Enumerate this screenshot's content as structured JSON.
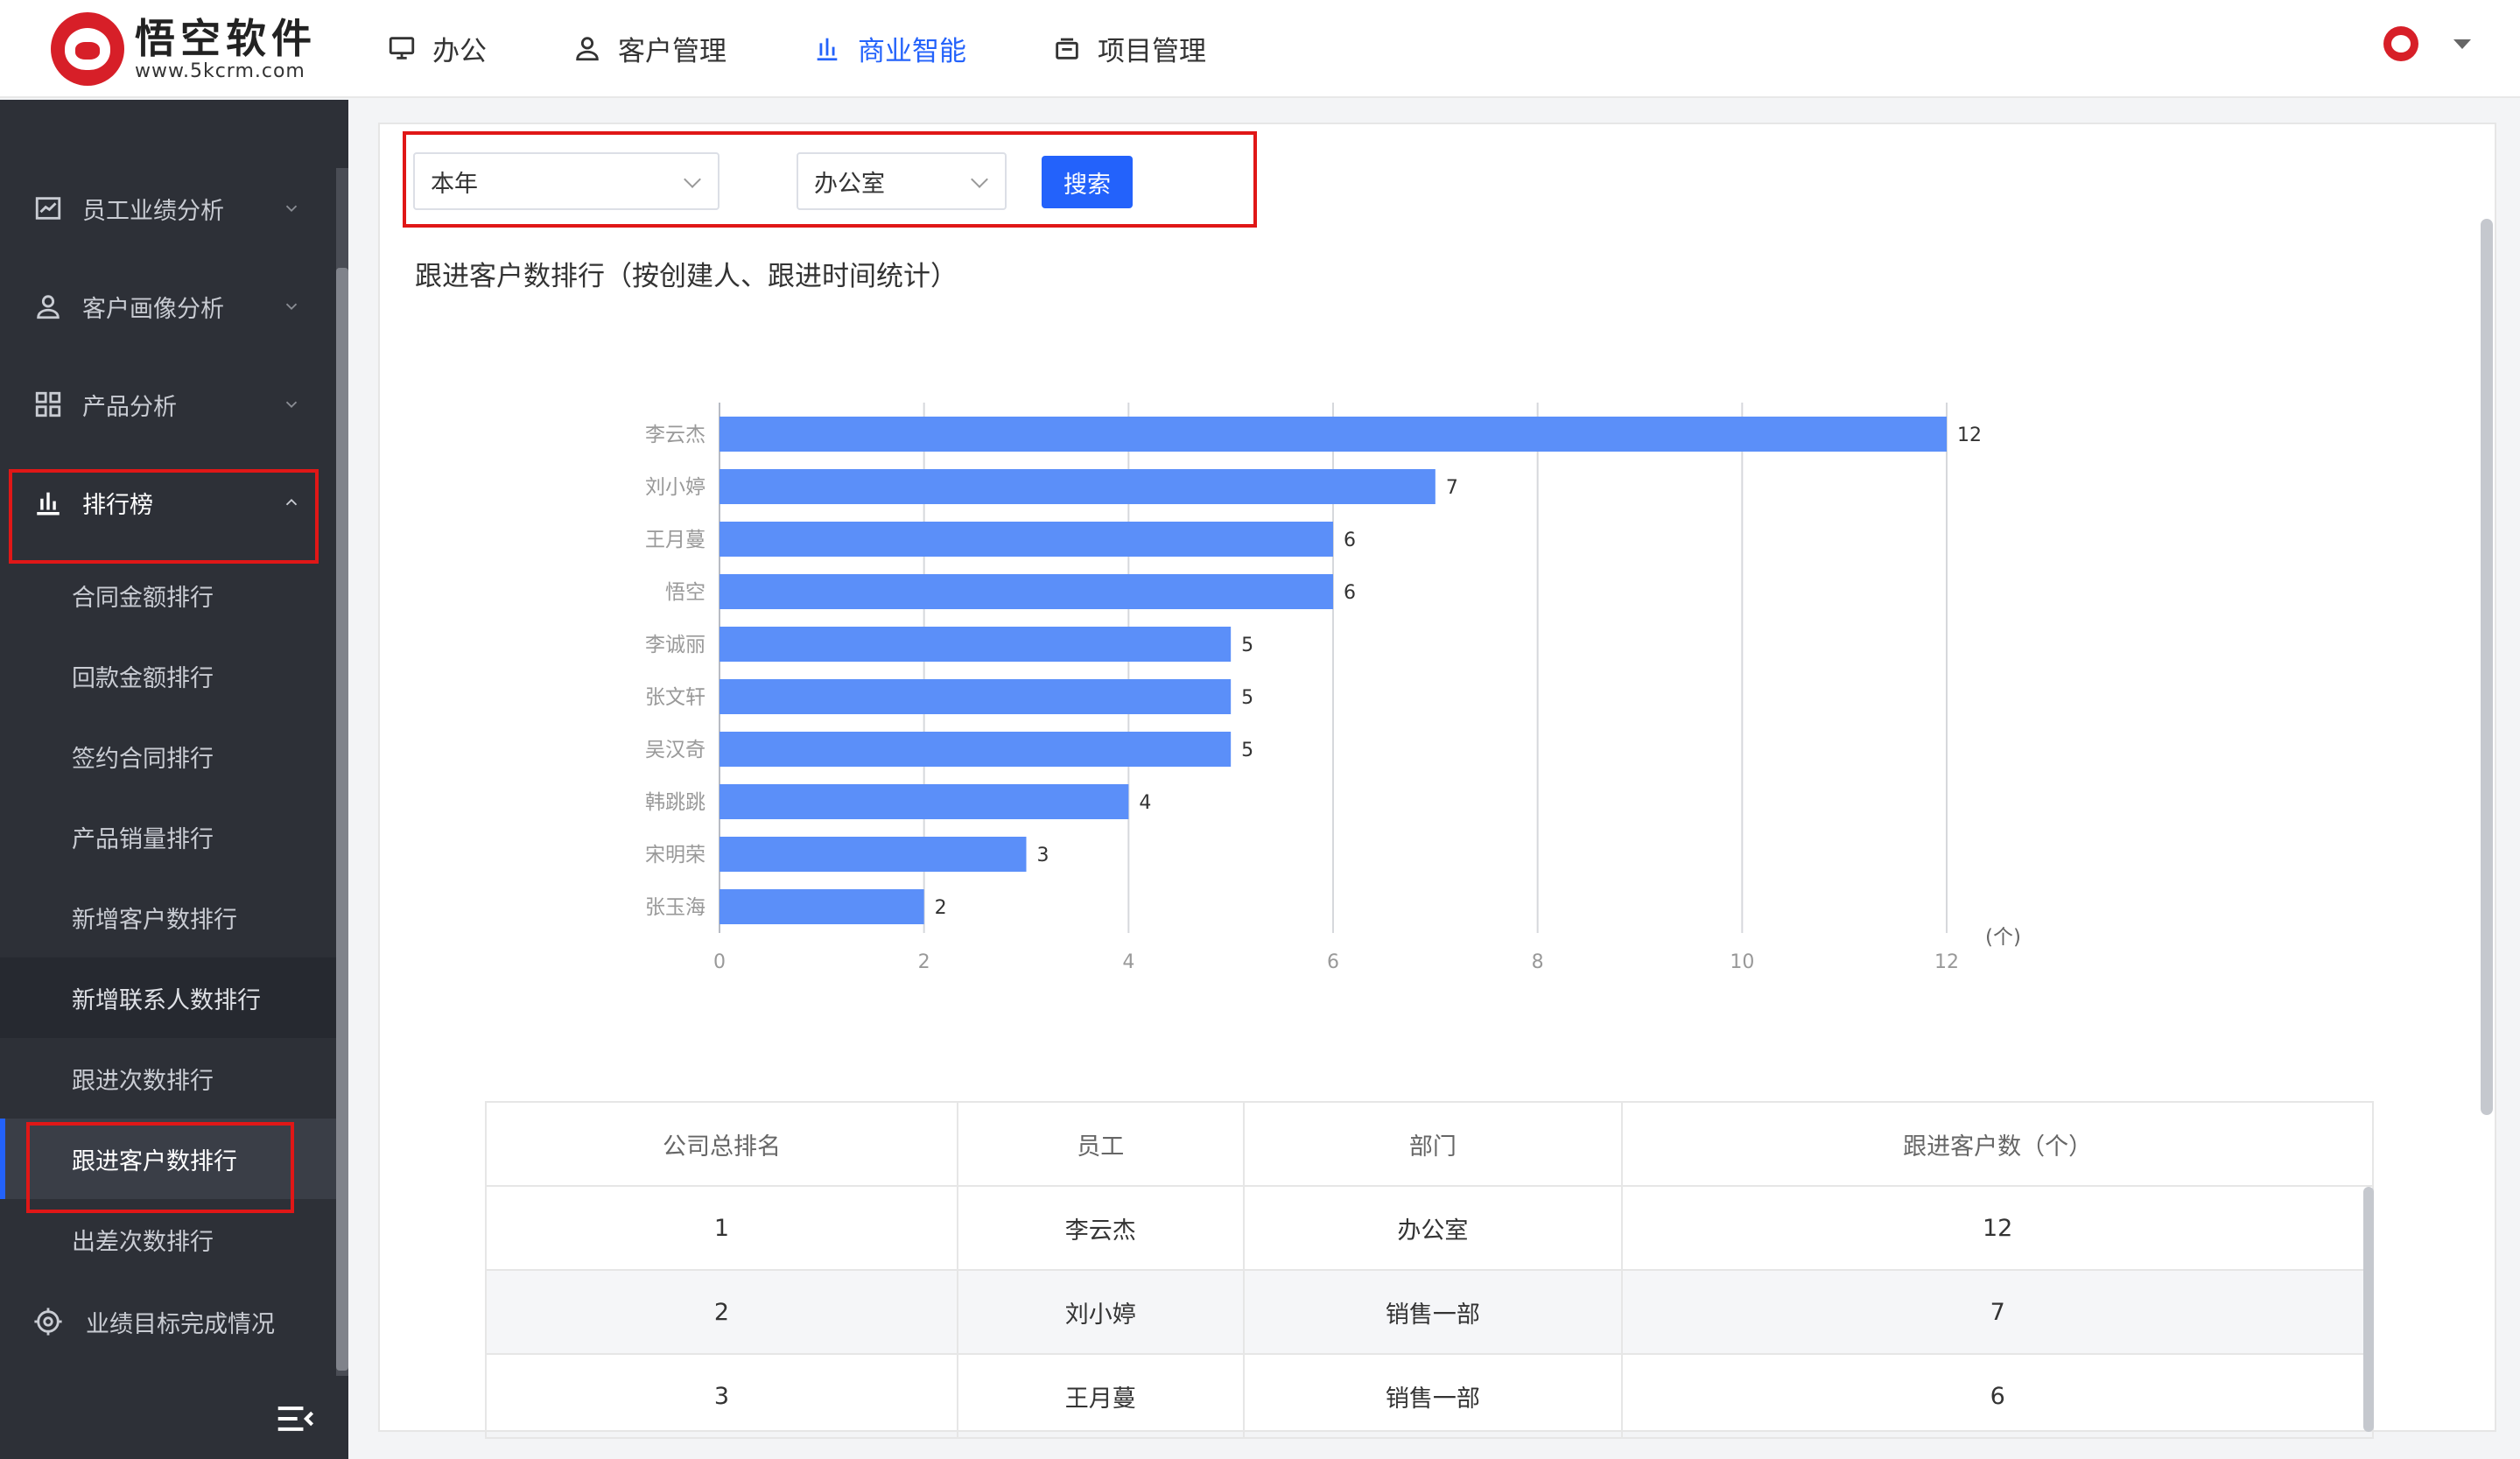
{
  "brand": {
    "name": "悟空软件",
    "url": "www.5kcrm.com"
  },
  "nav": [
    {
      "label": "办公",
      "icon": "monitor-icon",
      "active": false
    },
    {
      "label": "客户管理",
      "icon": "user-icon",
      "active": false
    },
    {
      "label": "商业智能",
      "icon": "bar-chart-icon",
      "active": true
    },
    {
      "label": "项目管理",
      "icon": "project-icon",
      "active": false
    }
  ],
  "sidebar": {
    "groups": [
      {
        "label": "员工业绩分析",
        "icon": "line-chart-icon",
        "expanded": false
      },
      {
        "label": "客户画像分析",
        "icon": "user-profile-icon",
        "expanded": false
      },
      {
        "label": "产品分析",
        "icon": "grid-icon",
        "expanded": false
      },
      {
        "label": "排行榜",
        "icon": "bar-chart-icon",
        "expanded": true
      }
    ],
    "subitems": [
      "合同金额排行",
      "回款金额排行",
      "签约合同排行",
      "产品销量排行",
      "新增客户数排行",
      "新增联系人数排行",
      "跟进次数排行",
      "跟进客户数排行",
      "出差次数排行"
    ],
    "active_subitem": "跟进客户数排行",
    "bottom_item": {
      "label": "业绩目标完成情况",
      "icon": "target-icon"
    }
  },
  "filters": {
    "period": "本年",
    "department": "办公室",
    "search_label": "搜索"
  },
  "chart_title": "跟进客户数排行（按创建人、跟进时间统计）",
  "chart_data": {
    "type": "bar",
    "orientation": "horizontal",
    "categories": [
      "李云杰",
      "刘小婷",
      "王月蔓",
      "悟空",
      "李诚丽",
      "张文轩",
      "吴汉奇",
      "韩跳跳",
      "宋明荣",
      "张玉海"
    ],
    "values": [
      12,
      7,
      6,
      6,
      5,
      5,
      5,
      4,
      3,
      2
    ],
    "xlim": [
      0,
      12
    ],
    "xticks": [
      0,
      2,
      4,
      6,
      8,
      10,
      12
    ],
    "unit_label": "(个)",
    "bar_color": "#5b8ff9",
    "grid": true
  },
  "table": {
    "headers": [
      "公司总排名",
      "员工",
      "部门",
      "跟进客户数（个）"
    ],
    "rows": [
      [
        "1",
        "李云杰",
        "办公室",
        "12"
      ],
      [
        "2",
        "刘小婷",
        "销售一部",
        "7"
      ],
      [
        "3",
        "王月蔓",
        "销售一部",
        "6"
      ]
    ]
  }
}
